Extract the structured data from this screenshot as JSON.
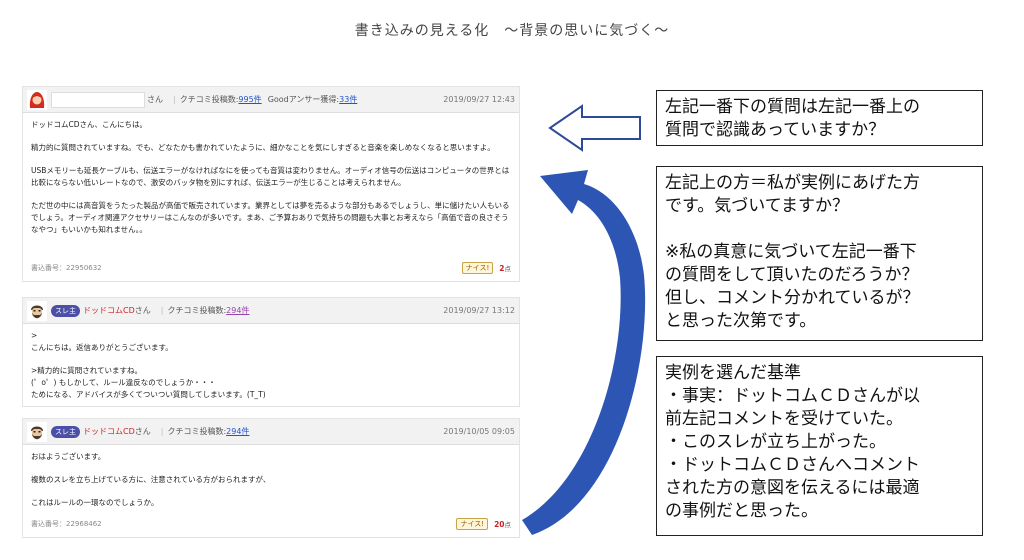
{
  "title": "書き込みの見える化　〜背景の思いに気づく〜",
  "posts": [
    {
      "suffix": "さん",
      "count_label": "クチコミ投稿数:",
      "count": "995件",
      "good_label": "Goodアンサー獲得:",
      "good": "33件",
      "date": "2019/09/27 12:43",
      "body": [
        "ドッドコムCDさん、こんにちは。",
        "精力的に質問されていますね。でも、どなたかも書かれていたように、細かなことを気にしすぎると音楽を楽しめなくなると思いますよ。",
        "USBメモリーも延長ケーブルも、伝送エラーがなければなにを使っても音質は変わりません。オーディオ信号の伝送はコンピュータの世界とは比較にならない低いレートなので、激安のバッタ物を別にすれば、伝送エラーが生じることは考えられません。",
        "ただ世の中には高音質をうたった製品が高価で販売されています。業界としては夢を売るような部分もあるでしょうし、単に儲けたい人もいるでしょう。オーディオ関連アクセサリーはこんなのが多いです。まあ、ご予算おありで気持ちの問題も大事とお考えなら「高価で音の良さそうなやつ」もいいかも知れません。。"
      ],
      "post_no": "書込番号：22950632",
      "nice": "ナイス!",
      "points": "2",
      "points_unit": "点"
    },
    {
      "thread_badge": "スレ主",
      "user": "ドッドコムCD",
      "suffix": "さん",
      "count_label": "クチコミ投稿数:",
      "count": "294件",
      "date": "2019/09/27 13:12",
      "body": [
        ">",
        "こんにちは。返信ありがとうございます。",
        ">精力的に質問されていますね。",
        "(゜o゜) もしかして、ルール違反なのでしょうか・・・",
        "ためになる、アドバイスが多くてついつい質問してしまいます。(T_T)"
      ]
    },
    {
      "thread_badge": "スレ主",
      "user": "ドッドコムCD",
      "suffix": "さん",
      "count_label": "クチコミ投稿数:",
      "count": "294件",
      "date": "2019/10/05 09:05",
      "body": [
        "おはようございます。",
        "複数のスレを立ち上げている方に、注意されている方がおられますが、",
        "これはルールの一環なのでしょうか。"
      ],
      "post_no": "書込番号：22968462",
      "nice": "ナイス!",
      "points": "20",
      "points_unit": "点"
    }
  ],
  "callouts": {
    "c1": "左記一番下の質問は左記一番上の\n質問で認識あっていますか？",
    "c2": "左記上の方＝私が実例にあげた方\nです。気づいてますか？\n\n※私の真意に気づいて左記一番下\nの質問をして頂いたのだろうか？\n但し、コメント分かれているが？\nと思った次第です。",
    "c3": "実例を選んだ基準\n・事実：ドットコムＣＤさんが以\n前左記コメントを受けていた。\n・このスレが立ち上がった。\n・ドットコムＣＤさんへコメント\nされた方の意図を伝えるには最適\nの事例だと思った。"
  },
  "colors": {
    "accent_blue": "#2d4a9a",
    "arrow_outline": "#2d4a9a"
  }
}
